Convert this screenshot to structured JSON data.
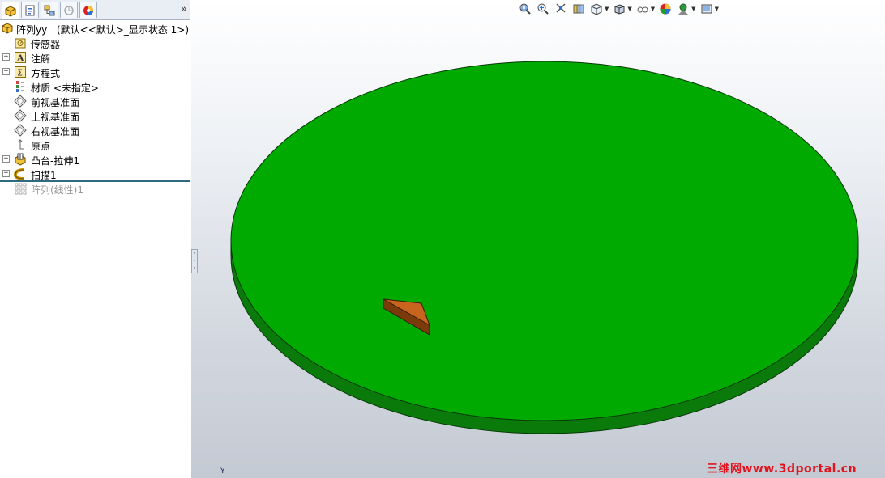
{
  "panel": {
    "tabs": [
      "feature-manager",
      "property-manager",
      "configuration-manager",
      "dimxpert-manager",
      "display-manager"
    ],
    "expand_glyph": "»"
  },
  "tree": {
    "root": {
      "label": "阵列yy",
      "config": "(默认<<默认>_显示状态 1>)"
    },
    "items": [
      {
        "label": "传感器",
        "icon": "sensor-icon",
        "expandable": false
      },
      {
        "label": "注解",
        "icon": "annotations-icon",
        "expandable": true
      },
      {
        "label": "方程式",
        "icon": "equations-icon",
        "expandable": true
      },
      {
        "label": "材质 <未指定>",
        "icon": "material-icon",
        "expandable": false
      },
      {
        "label": "前视基准面",
        "icon": "plane-icon",
        "expandable": false
      },
      {
        "label": "上视基准面",
        "icon": "plane-icon",
        "expandable": false
      },
      {
        "label": "右视基准面",
        "icon": "plane-icon",
        "expandable": false
      },
      {
        "label": "原点",
        "icon": "origin-icon",
        "expandable": false
      },
      {
        "label": "凸台-拉伸1",
        "icon": "boss-extrude-icon",
        "expandable": true
      },
      {
        "label": "扫描1",
        "icon": "sweep-icon",
        "expandable": true
      },
      {
        "label": "阵列(线性)1",
        "icon": "linear-pattern-icon",
        "expandable": false,
        "suppressed": true
      }
    ]
  },
  "viewport": {
    "toolbar": [
      "zoom-to-fit-icon",
      "zoom-to-area-icon",
      "previous-view-icon",
      "section-view-icon",
      "view-orientation-icon",
      "display-style-icon",
      "hide-show-items-icon",
      "edit-appearance-icon",
      "apply-scene-icon",
      "view-settings-icon"
    ],
    "triad_label": "Y",
    "watermark": "三维网www.3dportal.cn",
    "colors": {
      "disc_top": "#00aa00",
      "disc_side": "#0a7a0a",
      "wedge_top": "#c8641e",
      "wedge_side": "#7a3a0a",
      "watermark": "#e0141e"
    }
  }
}
